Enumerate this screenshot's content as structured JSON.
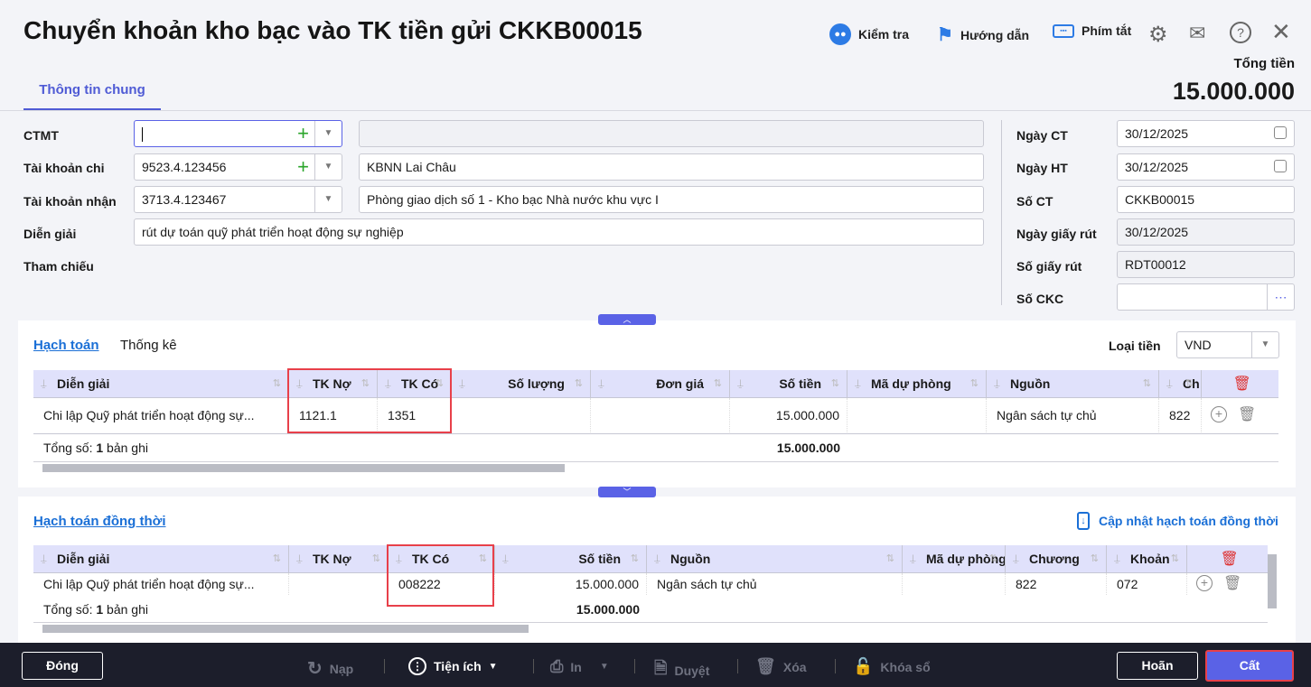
{
  "header": {
    "title": "Chuyển khoản kho bạc vào TK tiền gửi CKKB00015",
    "check": "Kiểm tra",
    "guide": "Hướng dẫn",
    "shortcuts": "Phím tắt",
    "total_label": "Tổng tiền",
    "total_value": "15.000.000"
  },
  "tabs": [
    {
      "label": "Thông tin chung",
      "active": true
    }
  ],
  "form": {
    "ctmt": {
      "label": "CTMT",
      "value": "",
      "desc": ""
    },
    "tk_chi": {
      "label": "Tài khoản chi",
      "value": "9523.4.123456",
      "desc": "KBNN Lai Châu"
    },
    "tk_nhan": {
      "label": "Tài khoản nhận",
      "value": "3713.4.123467",
      "desc": "Phòng giao dịch số 1 - Kho bạc Nhà nước khu vực I"
    },
    "dien_giai": {
      "label": "Diễn giải",
      "value": "rút dự toán quỹ phát triển hoạt động sự nghiệp"
    },
    "tham_chieu": {
      "label": "Tham chiếu"
    },
    "ngay_ct": {
      "label": "Ngày CT",
      "value": "30/12/2025"
    },
    "ngay_ht": {
      "label": "Ngày HT",
      "value": "30/12/2025"
    },
    "so_ct": {
      "label": "Số CT",
      "value": "CKKB00015"
    },
    "ngay_giay_rut": {
      "label": "Ngày giấy rút",
      "value": "30/12/2025"
    },
    "so_giay_rut": {
      "label": "Số giấy rút",
      "value": "RDT00012"
    },
    "so_ckc": {
      "label": "Số CKC",
      "value": ""
    }
  },
  "section1": {
    "tab_active": "Hạch toán",
    "tab_other": "Thống kê",
    "currency_label": "Loại tiền",
    "currency": "VND",
    "columns": [
      "Diễn giải",
      "TK Nợ",
      "TK Có",
      "Số lượng",
      "Đơn giá",
      "Số tiền",
      "Mã dự phòng",
      "Nguồn",
      "Ch"
    ],
    "rows": [
      [
        "Chi lập Quỹ phát triển hoạt động sự...",
        "1121.1",
        "1351",
        "",
        "",
        "15.000.000",
        "",
        "Ngân sách tự chủ",
        "822"
      ]
    ],
    "total_prefix": "Tổng số: ",
    "total_count": "1",
    "total_suffix": " bản ghi",
    "total_amount": "15.000.000"
  },
  "section2": {
    "title": "Hạch toán đồng thời",
    "update_link": "Cập nhật hạch toán đồng thời",
    "columns": [
      "Diễn giải",
      "TK Nợ",
      "TK Có",
      "Số tiền",
      "Nguồn",
      "Mã dự phòng",
      "Chương",
      "Khoản"
    ],
    "rows": [
      [
        "Chi lập Quỹ phát triển hoạt động sự...",
        "",
        "008222",
        "15.000.000",
        "Ngân sách tự chủ",
        "",
        "822",
        "072"
      ]
    ],
    "total_prefix": "Tổng số: ",
    "total_count": "1",
    "total_suffix": " bản ghi",
    "total_amount": "15.000.000"
  },
  "footer": {
    "close": "Đóng",
    "reload": "Nạp",
    "utilities": "Tiện ích",
    "print": "In",
    "approve": "Duyệt",
    "delete": "Xóa",
    "lock": "Khóa sổ",
    "cancel": "Hoãn",
    "save": "Cất"
  },
  "colors": {
    "accent": "#5a62e6",
    "highlight": "#e8404a",
    "footer_bg": "#1c1e2b"
  }
}
